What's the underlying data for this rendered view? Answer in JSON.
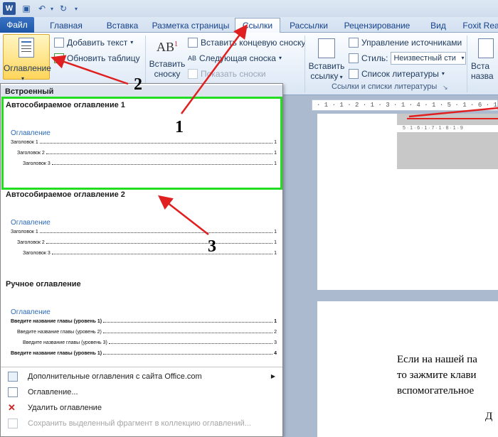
{
  "qat": {
    "icons": [
      "word-logo-icon",
      "save-icon",
      "undo-icon",
      "redo-icon"
    ]
  },
  "tabs": [
    "Файл",
    "Главная",
    "Вставка",
    "Разметка страницы",
    "Ссылки",
    "Рассылки",
    "Рецензирование",
    "Вид",
    "Foxit Rea"
  ],
  "ribbon": {
    "toc_button": "Оглавление",
    "add_text": "Добавить текст",
    "update_table": "Обновить таблицу",
    "insert_footnote_1": "Вставить",
    "insert_footnote_2": "сноску",
    "insert_endnote": "Вставить концевую сноску",
    "next_footnote": "Следующая сноска",
    "show_notes": "Показать сноски",
    "insert_citation_1": "Вставить",
    "insert_citation_2": "ссылку",
    "manage_sources": "Управление источниками",
    "style_label": "Стиль:",
    "style_value": "Неизвестный сти",
    "bibliography": "Список литературы",
    "group_citations": "Ссылки и списки литературы",
    "insert_caption_1": "Вста",
    "insert_caption_2": "назва"
  },
  "gallery": {
    "builtin_header": "Встроенный",
    "auto1_title": "Автособираемое оглавление 1",
    "auto2_title": "Автособираемое оглавление 2",
    "manual_title": "Ручное оглавление",
    "toc_heading": "Оглавление",
    "auto_lines": [
      {
        "text": "Заголовок 1",
        "page": "1"
      },
      {
        "text": "Заголовок 2",
        "page": "1"
      },
      {
        "text": "Заголовок 3",
        "page": "1"
      }
    ],
    "manual_lines": [
      {
        "text": "Введите название главы (уровень 1)",
        "page": "1"
      },
      {
        "text": "Введите название главы (уровень 2)",
        "page": "2"
      },
      {
        "text": "Введите название главы (уровень 3)",
        "page": "3"
      },
      {
        "text": "Введите название главы (уровень 1)",
        "page": "4"
      }
    ],
    "menu": [
      "Дополнительные оглавления с сайта Office.com",
      "Оглавление...",
      "Удалить оглавление",
      "Сохранить выделенный фрагмент в коллекцию оглавлений..."
    ]
  },
  "ruler_text": "· 1 · 1 · 2 · 1 · 3 · 1 · 4 · 1 · 5 · 1 · 6 · 1 · 7 · 1 · 8 · 1 · 9 · 1 · 10",
  "ruler2_text": "5 · 1 · 6 · 1 · 7 · 1 · 8 · 1 · 9",
  "document_lines": [
    "Если на нашей па",
    "то зажмите клави",
    "вспомогательное",
    "Д"
  ],
  "annotations": {
    "n1": "1",
    "n2": "2",
    "n3": "3"
  },
  "colors": {
    "highlight": "#22dd22",
    "arrow": "#e02020",
    "file_tab": "#2a63b6"
  }
}
